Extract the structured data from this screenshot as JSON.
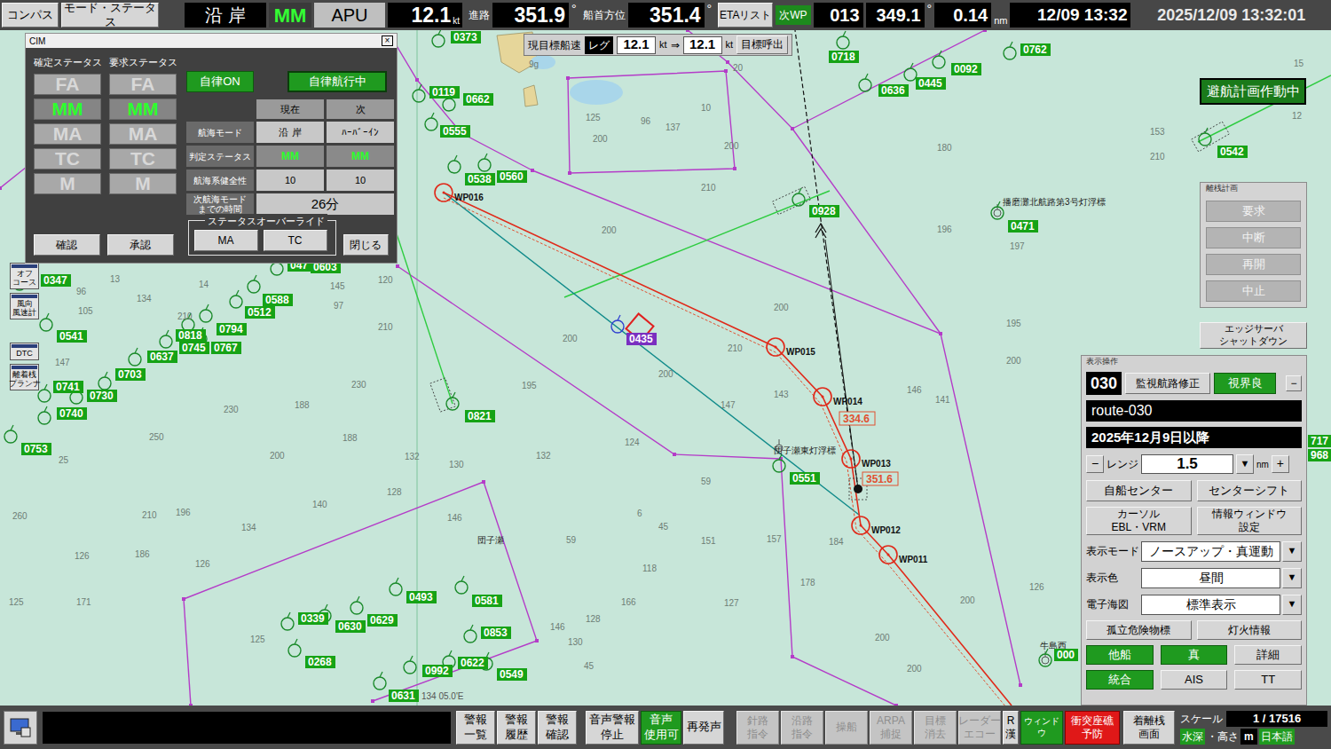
{
  "topBar": {
    "compassButton": "コンパス",
    "modeStatusButton": "モード・ステータス",
    "navArea": "沿 岸",
    "mode": "MM",
    "apu": "APU",
    "speed": "12.1",
    "speedUnit": "kt",
    "courseLabel": "進路",
    "course": "351.9",
    "deg": "°",
    "headingLabel": "船首方位",
    "heading": "351.4",
    "etaButton": "ETAリスト",
    "nextWpLabel": "次WP",
    "nextWp": "013",
    "nextWpBearing": "349.1",
    "nextWpDistance": "0.14",
    "distanceUnit": "nm",
    "eta": "12/09 13:32",
    "clock": "2025/12/09 13:32:01"
  },
  "cim": {
    "title": "CIM",
    "close": "×",
    "confirmedLabel": "確定ステータス",
    "requestedLabel": "要求ステータス",
    "confirmed": [
      {
        "label": "FA",
        "selected": false
      },
      {
        "label": "MM",
        "selected": true
      },
      {
        "label": "MA",
        "selected": false
      },
      {
        "label": "TC",
        "selected": false
      },
      {
        "label": "M",
        "selected": false
      }
    ],
    "requested": [
      {
        "label": "FA",
        "selected": false
      },
      {
        "label": "MM",
        "selected": true
      },
      {
        "label": "MA",
        "selected": false
      },
      {
        "label": "TC",
        "selected": false
      },
      {
        "label": "M",
        "selected": false
      }
    ],
    "autonomyButton": {
      "label": "自律ON",
      "on": true
    },
    "autonomyStatus": "自律航行中",
    "table": {
      "columns": [
        "現在",
        "次"
      ],
      "rows": [
        {
          "lines": [
            "航海モード"
          ],
          "values": [
            "沿 岸",
            "ﾊｰﾊﾞｰｲﾝ"
          ],
          "kind": "text"
        },
        {
          "lines": [
            "判定ステータス"
          ],
          "values": [
            "MM",
            "MM"
          ],
          "kind": "status"
        },
        {
          "lines": [
            "航海系健全性"
          ],
          "values": [
            "10",
            "10"
          ],
          "kind": "text"
        },
        {
          "lines": [
            "次航海モード",
            "までの時間"
          ],
          "values": [
            "26分"
          ],
          "kind": "span"
        }
      ]
    },
    "buttons": [
      "確認",
      "承認"
    ],
    "overrideLabel": "ステータスオーバーライド",
    "overrideButtons": [
      "MA",
      "TC"
    ],
    "closeButton": "閉じる"
  },
  "speedTarget": {
    "label": "現目標船速",
    "leg": "レグ",
    "current": "12.1",
    "unit": "kt",
    "arrow": "⇒",
    "target": "12.1",
    "callButton": "目標呼出"
  },
  "avoidanceStatus": "避航計画作動中",
  "departurePlan": {
    "title": "離桟計画",
    "buttons": [
      {
        "label": "要求",
        "disabled": true
      },
      {
        "label": "中断",
        "disabled": true
      },
      {
        "label": "再開",
        "disabled": true
      },
      {
        "label": "中止",
        "disabled": true
      }
    ]
  },
  "edgeShutdown": {
    "lines": [
      "エッジサーバ",
      "シャットダウン"
    ]
  },
  "leftTools": [
    {
      "lines": [
        "オフ",
        "コース"
      ]
    },
    {
      "lines": [
        "風向",
        "風速計"
      ]
    },
    {
      "lines": [
        "DTC"
      ]
    },
    {
      "lines": [
        "離着桟",
        "プランナ"
      ]
    }
  ],
  "displayPanel": {
    "title": "表示操作",
    "routeNo": "030",
    "monitorRouteButton": "監視航路修正",
    "visibility": {
      "label": "視界良",
      "on": true
    },
    "minimize": "−",
    "routeName": "route-030",
    "dateFrom": "2025年12月9日以降",
    "range": {
      "minus": "−",
      "label": "レンジ",
      "value": "1.5",
      "dropdown": "▼",
      "unit": "nm",
      "plus": "+"
    },
    "buttons1": [
      "自船センター",
      "センターシフト"
    ],
    "buttons2": [
      {
        "lines": [
          "カーソル",
          "EBL・VRM"
        ]
      },
      {
        "lines": [
          "情報ウィンドウ",
          "設定"
        ]
      }
    ],
    "selects": [
      {
        "label": "表示モード",
        "value": "ノースアップ・真運動",
        "dropdown": "▼"
      },
      {
        "label": "表示色",
        "value": "昼間",
        "dropdown": "▼"
      },
      {
        "label": "電子海図",
        "value": "標準表示",
        "dropdown": "▼"
      }
    ],
    "buttons3": [
      "孤立危険物標",
      "灯火情報"
    ],
    "toggles": [
      {
        "label": "他船",
        "on": true
      },
      {
        "label": "真",
        "on": true
      },
      {
        "label": "詳細",
        "on": false
      },
      {
        "label": "統合",
        "on": true
      },
      {
        "label": "AIS",
        "on": false
      },
      {
        "label": "TT",
        "on": false
      }
    ]
  },
  "bottomBar": {
    "alarmButtons": [
      {
        "lines": [
          "警報",
          "一覧"
        ]
      },
      {
        "lines": [
          "警報",
          "履歴"
        ]
      },
      {
        "lines": [
          "警報",
          "確認"
        ]
      }
    ],
    "audioButtons": [
      {
        "lines": [
          "音声警報",
          "停止"
        ],
        "on": false
      },
      {
        "lines": [
          "音声",
          "使用可"
        ],
        "on": true
      },
      {
        "lines": [
          "再発声"
        ],
        "on": false
      }
    ],
    "commandButtons": [
      {
        "lines": [
          "針路",
          "指令"
        ],
        "disabled": true
      },
      {
        "lines": [
          "沿路",
          "指令"
        ],
        "disabled": true
      },
      {
        "lines": [
          "操船"
        ],
        "disabled": true
      },
      {
        "lines": [
          "ARPA",
          "捕捉"
        ],
        "disabled": true
      },
      {
        "lines": [
          "目標",
          "消去"
        ],
        "disabled": true
      },
      {
        "lines": [
          "レーダー",
          "エコー"
        ],
        "disabled": true
      }
    ],
    "inputMode": {
      "lines": [
        "R",
        "漢"
      ]
    },
    "windowButton": {
      "label": "ウィンドウ",
      "on": true
    },
    "collisionButton": {
      "lines": [
        "衝突座礁",
        "予防"
      ],
      "alert": true
    },
    "berthingButton": {
      "lines": [
        "着離桟",
        "画面"
      ]
    },
    "scale": {
      "label": "スケール",
      "value": "1 / 17516"
    },
    "depthLabel": "水深",
    "heightLabel": "・高さ",
    "unit": "m",
    "language": "日本語"
  },
  "chart": {
    "waypoints": [
      {
        "name": "WP016"
      },
      {
        "name": "WP015"
      },
      {
        "name": "WP014"
      },
      {
        "name": "WP013"
      },
      {
        "name": "WP012"
      },
      {
        "name": "WP011"
      }
    ],
    "courseLabels": [
      "334.6",
      "351.6"
    ],
    "features": [
      "播磨灘北航路第3号灯浮標",
      "団子瀬東灯浮標",
      "団子瀬",
      "牛島西"
    ],
    "longitude": "134 05.0'E",
    "targets": [
      {
        "label": "0373",
        "selected": false
      },
      {
        "label": "0119",
        "selected": false
      },
      {
        "label": "0662",
        "selected": false
      },
      {
        "label": "0555",
        "selected": false
      },
      {
        "label": "0538",
        "selected": false
      },
      {
        "label": "0560",
        "selected": false
      },
      {
        "label": "0718",
        "selected": false
      },
      {
        "label": "0092",
        "selected": false
      },
      {
        "label": "0445",
        "selected": false
      },
      {
        "label": "0636",
        "selected": false
      },
      {
        "label": "0762",
        "selected": false
      },
      {
        "label": "0542",
        "selected": false
      },
      {
        "label": "0928",
        "selected": false
      },
      {
        "label": "0471",
        "selected": false
      },
      {
        "label": "047",
        "selected": false
      },
      {
        "label": "0603",
        "selected": false
      },
      {
        "label": "0347",
        "selected": false
      },
      {
        "label": "0588",
        "selected": false
      },
      {
        "label": "0512",
        "selected": false
      },
      {
        "label": "0794",
        "selected": false
      },
      {
        "label": "0818",
        "selected": false
      },
      {
        "label": "0745",
        "selected": false
      },
      {
        "label": "0767",
        "selected": false
      },
      {
        "label": "0637",
        "selected": false
      },
      {
        "label": "0541",
        "selected": false
      },
      {
        "label": "0703",
        "selected": false
      },
      {
        "label": "0741",
        "selected": false
      },
      {
        "label": "0730",
        "selected": false
      },
      {
        "label": "0740",
        "selected": false
      },
      {
        "label": "0753",
        "selected": false
      },
      {
        "label": "0821",
        "selected": false
      },
      {
        "label": "0551",
        "selected": false
      },
      {
        "label": "0493",
        "selected": false
      },
      {
        "label": "0581",
        "selected": false
      },
      {
        "label": "0339",
        "selected": false
      },
      {
        "label": "0630",
        "selected": false
      },
      {
        "label": "0629",
        "selected": false
      },
      {
        "label": "0853",
        "selected": false
      },
      {
        "label": "0268",
        "selected": false
      },
      {
        "label": "0622",
        "selected": false
      },
      {
        "label": "0992",
        "selected": false
      },
      {
        "label": "0549",
        "selected": false
      },
      {
        "label": "0631",
        "selected": false
      },
      {
        "label": "000",
        "selected": false
      },
      {
        "label": "717",
        "selected": false
      },
      {
        "label": "968",
        "selected": false
      },
      {
        "label": "0435",
        "selected": true
      }
    ],
    "soundings": [
      "9g",
      "20",
      "125",
      "96",
      "137",
      "10",
      "200",
      "200",
      "210",
      "180",
      "153",
      "210",
      "15",
      "12",
      "196",
      "197",
      "195",
      "200",
      "200",
      "210",
      "200",
      "200",
      "195",
      "147",
      "143",
      "146",
      "200",
      "141",
      "124",
      "132",
      "59",
      "6",
      "45",
      "151",
      "157",
      "184",
      "178",
      "127",
      "166",
      "126",
      "200",
      "200",
      "200",
      "59",
      "118",
      "128",
      "146",
      "130",
      "45",
      "140",
      "128",
      "146",
      "130",
      "132",
      "200",
      "96",
      "105",
      "134",
      "13",
      "14",
      "210",
      "145",
      "97",
      "120",
      "147",
      "230",
      "230",
      "250",
      "188",
      "188",
      "25",
      "210",
      "196",
      "134",
      "260",
      "126",
      "186",
      "126",
      "171",
      "125",
      "125",
      "210"
    ]
  }
}
